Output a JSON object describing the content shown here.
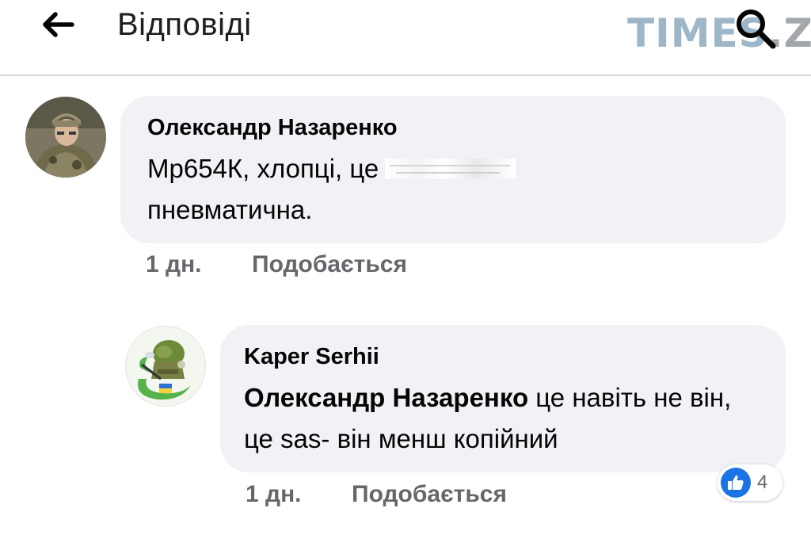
{
  "header": {
    "title": "Відповіді",
    "back_icon": "arrow-left-icon"
  },
  "watermark": {
    "brand_main": "TIMES",
    "brand_suffix": ".ZT",
    "icon": "search-icon"
  },
  "comments": [
    {
      "author": "Олександр Назаренко",
      "text_before": "Мр654К, хлопці, це",
      "text_after": "пневматична.",
      "time": "1 дн.",
      "like_label": "Подобається"
    },
    {
      "author": "Kaper Serhii",
      "mention": "Олександр Назаренко",
      "text": "це навіть не він, це sas- він менш копійний",
      "time": "1 дн.",
      "like_label": "Подобається",
      "reaction_count": "4",
      "reaction_icon": "thumbs-up-icon"
    }
  ],
  "colors": {
    "bubble": "#f0f2f5",
    "meta_text": "#65676b",
    "like_blue": "#1b74e4",
    "watermark_blue": "#9db7c8",
    "watermark_grey": "#a3a7ab"
  }
}
